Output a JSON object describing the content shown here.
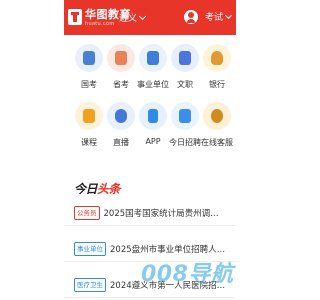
{
  "header": {
    "logo_name": "华图教育",
    "logo_domain": "huatu.com",
    "city": "遵义",
    "exam_select": "考试",
    "colors": {
      "brand": "#e7352a"
    }
  },
  "grid": {
    "items": [
      {
        "label": "国考",
        "icon": "building-icon",
        "bg": "#e9f0fb",
        "fg": "#4a7fd6"
      },
      {
        "label": "省考",
        "icon": "document-icon",
        "bg": "#fde9e3",
        "fg": "#e9805a"
      },
      {
        "label": "事业单位",
        "icon": "badge-icon",
        "bg": "#e9f1fb",
        "fg": "#3f7ed8"
      },
      {
        "label": "文职",
        "icon": "book-icon",
        "bg": "#e7eefc",
        "fg": "#4d73dc"
      },
      {
        "label": "银行",
        "icon": "coin-bag-icon",
        "bg": "#fff3da",
        "fg": "#e09a33"
      },
      {
        "label": "课程",
        "icon": "book-open-icon",
        "bg": "#fff1da",
        "fg": "#f0a21f"
      },
      {
        "label": "直播",
        "icon": "play-icon",
        "bg": "#e8f0fb",
        "fg": "#4379d4"
      },
      {
        "label": "APP",
        "icon": "phone-icon",
        "bg": "#e7f1fe",
        "fg": "#2f8be8"
      },
      {
        "label": "今日招聘",
        "icon": "calendar-icon",
        "bg": "#e8f3fd",
        "fg": "#3a8ee6"
      },
      {
        "label": "在线客服",
        "icon": "headset-icon",
        "bg": "#fdf0d6",
        "fg": "#d08b20"
      }
    ]
  },
  "headline": {
    "part1": "今日",
    "part2": "头条"
  },
  "news": [
    {
      "tag": "公务员",
      "tag_color": "#e7352a",
      "title": "2025国考国家统计局贵州调查..."
    },
    {
      "tag": "事业单位",
      "tag_color": "#2f8be8",
      "title": "2025盘州市事业单位招聘人员..."
    },
    {
      "tag": "医疗卫生",
      "tag_color": "#2f8be8",
      "title": "2024遵义市第一人民医院招聘..."
    }
  ],
  "watermark": {
    "text": "008导航"
  }
}
